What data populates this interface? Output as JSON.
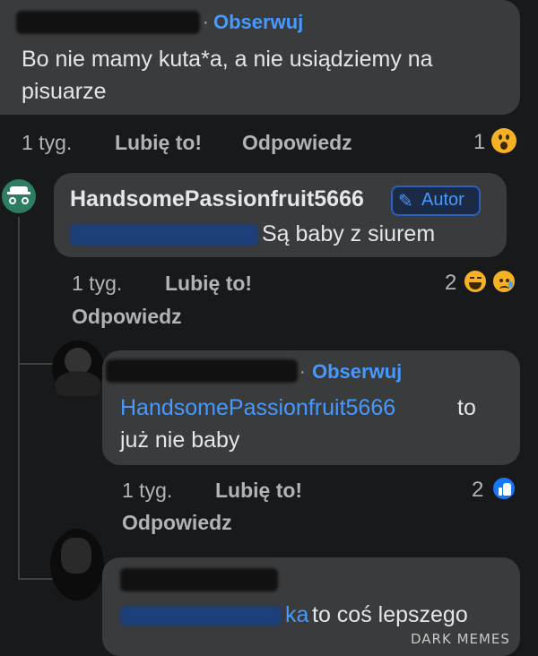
{
  "comment1": {
    "follow": "Obserwuj",
    "text": "Bo nie mamy kuta*a, a nie usiądziemy na pisuarze",
    "time": "1 tyg.",
    "like": "Lubię to!",
    "reply": "Odpowiedz",
    "reactions_count": "1",
    "reaction_icon": "wow-emoji-icon"
  },
  "reply1": {
    "author": "HandsomePassionfruit5666",
    "badge_label": "Autor",
    "text": "Są baby z siurem",
    "time": "1 tyg.",
    "like": "Lubię to!",
    "reply": "Odpowiedz",
    "reactions_count": "2",
    "reaction_icons": [
      "haha-emoji-icon",
      "sad-emoji-icon"
    ]
  },
  "reply2": {
    "follow": "Obserwuj",
    "mention": "HandsomePassionfruit5666",
    "text_after_mention": "to",
    "text_line2": "już nie baby",
    "time": "1 tyg.",
    "like": "Lubię to!",
    "reply": "Odpowiedz",
    "reactions_count": "2",
    "reaction_icon": "like-icon"
  },
  "reply3": {
    "mention_tail": "ka",
    "text": "to coś lepszego"
  },
  "watermark": "DARK MEMES",
  "colors": {
    "background": "#18191a",
    "bubble": "#3a3b3c",
    "link_blue": "#4599ff",
    "text": "#e4e6eb",
    "muted": "#b0b3b8"
  }
}
